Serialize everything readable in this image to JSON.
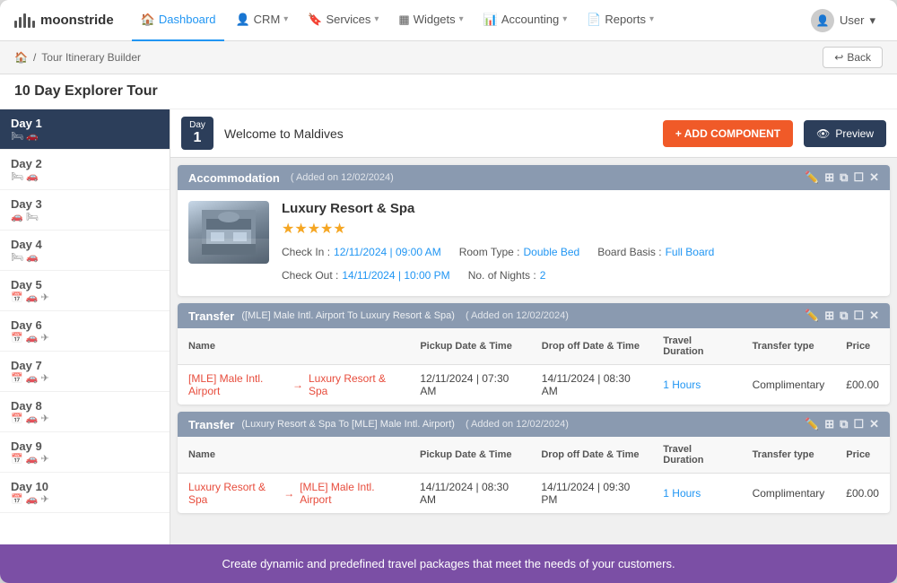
{
  "app": {
    "logo": "moonstride",
    "logo_icon_bars": [
      6,
      9,
      12,
      9,
      6
    ]
  },
  "navbar": {
    "items": [
      {
        "label": "Dashboard",
        "icon": "🏠",
        "active": true,
        "has_caret": false
      },
      {
        "label": "CRM",
        "icon": "👤",
        "active": false,
        "has_caret": true
      },
      {
        "label": "Services",
        "icon": "🔖",
        "active": false,
        "has_caret": true
      },
      {
        "label": "Widgets",
        "icon": "▦",
        "active": false,
        "has_caret": true
      },
      {
        "label": "Accounting",
        "icon": "📊",
        "active": false,
        "has_caret": true
      },
      {
        "label": "Reports",
        "icon": "📄",
        "active": false,
        "has_caret": true
      }
    ],
    "user_label": "User",
    "user_caret": "▾"
  },
  "breadcrumb": {
    "home_icon": "🏠",
    "separator": "/",
    "path": "Tour Itinerary Builder",
    "back_label": "↩ Back"
  },
  "page": {
    "title": "10 Day Explorer Tour"
  },
  "sidebar": {
    "days": [
      {
        "label": "Day 1",
        "icons": "🛏 🚗",
        "active": true
      },
      {
        "label": "Day 2",
        "icons": "🛏 🚗",
        "active": false
      },
      {
        "label": "Day 3",
        "icons": "🚗 🛏",
        "active": false
      },
      {
        "label": "Day 4",
        "icons": "🛏 🚗",
        "active": false
      },
      {
        "label": "Day 5",
        "icons": "📅 🚗 ✈",
        "active": false
      },
      {
        "label": "Day 6",
        "icons": "📅 🚗 ✈",
        "active": false
      },
      {
        "label": "Day 7",
        "icons": "📅 🚗 ✈",
        "active": false
      },
      {
        "label": "Day 8",
        "icons": "📅 🚗 ✈",
        "active": false
      },
      {
        "label": "Day 9",
        "icons": "📅 🚗 ✈",
        "active": false
      },
      {
        "label": "Day 10",
        "icons": "📅 🚗 ✈",
        "active": false
      }
    ]
  },
  "day_header": {
    "day_word": "Day",
    "day_num": "1",
    "title": "Welcome to Maldives",
    "add_btn": "+ ADD COMPONENT",
    "preview_btn": "👁 Preview"
  },
  "accommodation": {
    "section_title": "Accommodation",
    "added_date": "( Added on 12/02/2024)",
    "hotel_name": "Luxury Resort & Spa",
    "stars": "★★★★★",
    "check_in_label": "Check In :",
    "check_in_value": "12/11/2024 | 09:00 AM",
    "room_type_label": "Room Type :",
    "room_type_value": "Double Bed",
    "board_basis_label": "Board Basis :",
    "board_basis_value": "Full Board",
    "check_out_label": "Check Out :",
    "check_out_value": "14/11/2024 | 10:00 PM",
    "nights_label": "No. of Nights :",
    "nights_value": "2"
  },
  "transfer1": {
    "section_title": "Transfer",
    "section_sub": "([MLE] Male Intl. Airport To Luxury Resort & Spa)",
    "added_date": "( Added on 12/02/2024)",
    "columns": [
      "Name",
      "Pickup Date & Time",
      "Drop off Date & Time",
      "Travel Duration",
      "Transfer type",
      "Price"
    ],
    "rows": [
      {
        "name_from": "[MLE] Male Intl. Airport",
        "name_to": "Luxury Resort & Spa",
        "pickup": "12/11/2024 | 07:30 AM",
        "dropoff": "14/11/2024 | 08:30 AM",
        "duration": "1 Hours",
        "transfer_type": "Complimentary",
        "price": "£00.00"
      }
    ]
  },
  "transfer2": {
    "section_title": "Transfer",
    "section_sub": "(Luxury Resort & Spa To [MLE] Male Intl. Airport)",
    "added_date": "( Added on 12/02/2024)",
    "columns": [
      "Name",
      "Pickup Date & Time",
      "Drop off Date & Time",
      "Travel Duration",
      "Transfer type",
      "Price"
    ],
    "rows": [
      {
        "name_from": "Luxury Resort & Spa",
        "name_to": "[MLE] Male Intl. Airport",
        "pickup": "14/11/2024 | 08:30 AM",
        "dropoff": "14/11/2024 | 09:30 PM",
        "duration": "1 Hours",
        "transfer_type": "Complimentary",
        "price": "£00.00"
      }
    ]
  },
  "footer": {
    "message": "Create dynamic and predefined travel packages that meet the needs of your customers."
  }
}
